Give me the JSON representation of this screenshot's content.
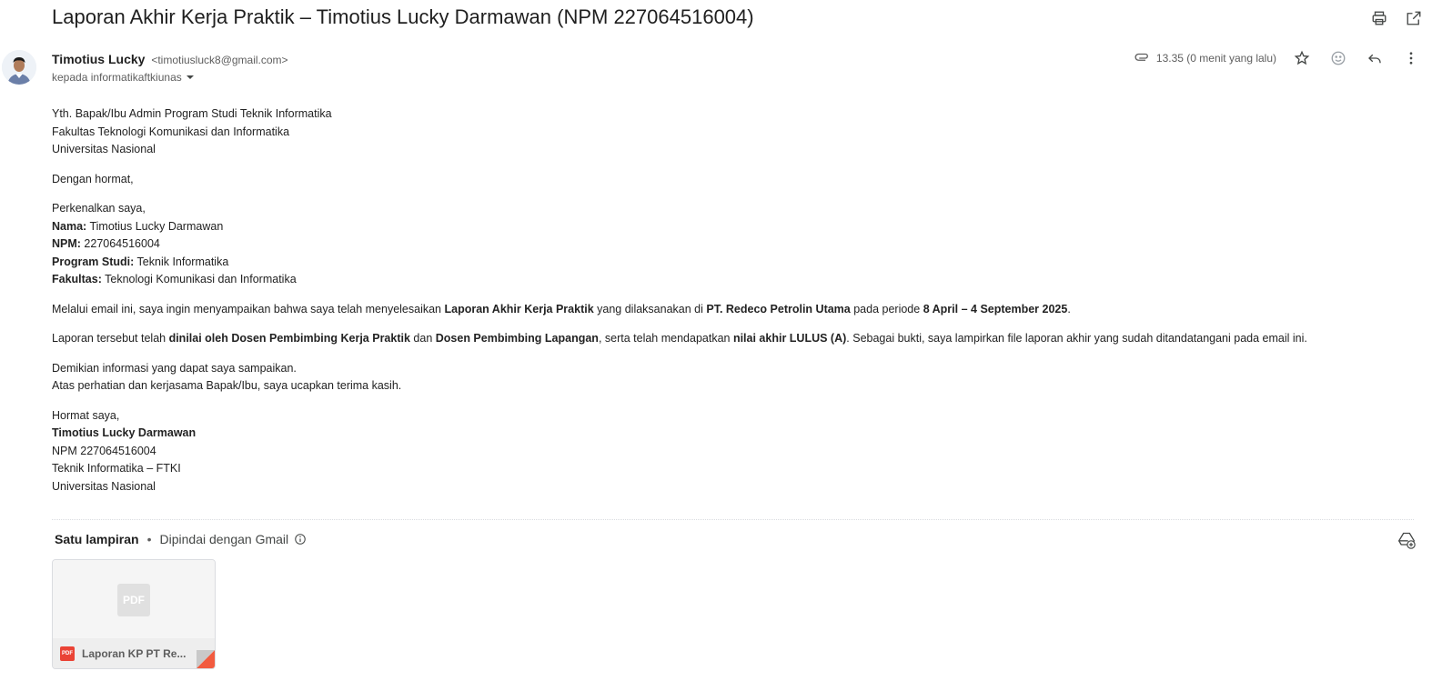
{
  "email": {
    "subject": "Laporan Akhir Kerja Praktik – Timotius Lucky Darmawan (NPM 227064516004)",
    "sender_name": "Timotius Lucky",
    "sender_email": "<timotiusluck8@gmail.com>",
    "recipient": "kepada informatikaftkiunas",
    "time": "13.35 (0 menit yang lalu)"
  },
  "toolbar": {
    "print_icon": "print-icon",
    "open_new_window_icon": "open-in-new-icon"
  },
  "actions": {
    "star_icon": "star-icon",
    "emoji_icon": "emoji-icon",
    "reply_icon": "reply-icon",
    "more_icon": "more-vert-icon"
  },
  "body": {
    "greeting_lines": [
      "Yth. Bapak/Ibu Admin Program Studi Teknik Informatika",
      "Fakultas Teknologi Komunikasi dan Informatika",
      "Universitas Nasional"
    ],
    "salutation": "Dengan hormat,",
    "intro": "Perkenalkan saya,",
    "fields": [
      {
        "label": "Nama:",
        "value": " Timotius Lucky Darmawan"
      },
      {
        "label": "NPM:",
        "value": " 227064516004"
      },
      {
        "label": "Program Studi:",
        "value": " Teknik Informatika"
      },
      {
        "label": "Fakultas:",
        "value": " Teknologi Komunikasi dan Informatika"
      }
    ],
    "para1": {
      "t1": "Melalui email ini, saya ingin menyampaikan bahwa saya telah menyelesaikan ",
      "b1": "Laporan Akhir Kerja Praktik",
      "t2": " yang dilaksanakan di ",
      "b2": "PT. Redeco Petrolin Utama",
      "t3": " pada periode ",
      "b3": "8 April – 4 September 2025",
      "t4": "."
    },
    "para2": {
      "t1": "Laporan tersebut telah ",
      "b1": "dinilai oleh Dosen Pembimbing Kerja Praktik",
      "t2": " dan ",
      "b2": "Dosen Pembimbing Lapangan",
      "t3": ", serta telah mendapatkan ",
      "b3": "nilai akhir LULUS (A)",
      "t4": ". Sebagai bukti, saya lampirkan file laporan akhir yang sudah ditandatangani pada email ini."
    },
    "closing_lines": [
      "Demikian informasi yang dapat saya sampaikan.",
      "Atas perhatian dan kerjasama Bapak/Ibu, saya ucapkan terima kasih."
    ],
    "signoff": "Hormat saya,",
    "signature_name": "Timotius Lucky Darmawan",
    "signature_lines": [
      "NPM 227064516004",
      "Teknik Informatika – FTKI",
      "Universitas Nasional"
    ]
  },
  "attachments": {
    "count_label": "Satu lampiran",
    "separator": "•",
    "scanned_label": "Dipindai dengan Gmail",
    "file_name": "Laporan KP PT Re...",
    "file_type": "PDF"
  }
}
